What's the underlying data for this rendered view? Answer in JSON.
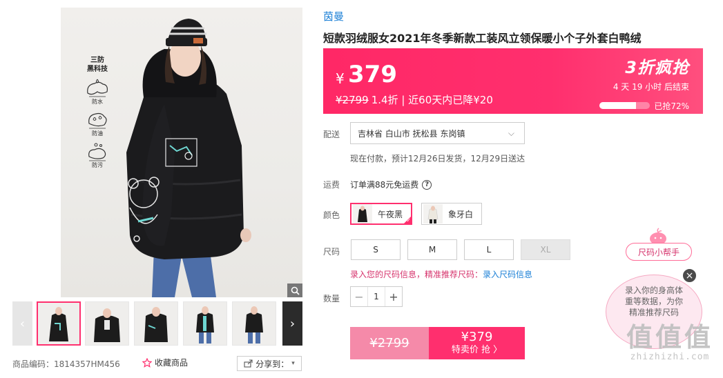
{
  "product": {
    "brand": "茵曼",
    "title": "短款羽绒服女2021年冬季新款工装风立领保暖小个子外套白鸭绒"
  },
  "gallery": {
    "tech_title_line1": "三防",
    "tech_title_line2": "黑科技",
    "features": [
      {
        "icon": "water-proof-icon",
        "label": "防水"
      },
      {
        "icon": "grease-proof-icon",
        "label": "防油"
      },
      {
        "icon": "anti-fouling-icon",
        "label": "防污"
      }
    ],
    "thumb_count": 5,
    "product_code": "商品编码：1814357HM456",
    "favorite_label": "收藏商品",
    "share_label": "分享到："
  },
  "pricing": {
    "currency": "¥",
    "price": "379",
    "original_price": "¥2799",
    "discount_text": "1.4折 | 近60天内已降¥20",
    "promo_label": "3折疯抢",
    "countdown": "4 天 19 小时 后结束",
    "sold_percent": 72,
    "sold_text": "已抢72%"
  },
  "delivery": {
    "label": "配送",
    "location": "吉林省 白山市 抚松县 东岗镇",
    "note": "现在付款，预计12月26日发货，12月29日送达"
  },
  "freight": {
    "label": "运费",
    "text": "订单满88元免运费"
  },
  "color": {
    "label": "颜色",
    "options": [
      {
        "name": "午夜黑",
        "selected": true
      },
      {
        "name": "象牙白",
        "selected": false
      }
    ]
  },
  "size": {
    "label": "尺码",
    "options": [
      {
        "name": "S",
        "disabled": false
      },
      {
        "name": "M",
        "disabled": false
      },
      {
        "name": "L",
        "disabled": false
      },
      {
        "name": "XL",
        "disabled": true
      }
    ],
    "help_text": "录入您的尺码信息，精准推荐尺码：",
    "help_link": "录入尺码信息"
  },
  "quantity": {
    "label": "数量",
    "value": "1",
    "minus": "−",
    "plus": "+"
  },
  "buy": {
    "was_price": "¥2799",
    "now_price": "¥379",
    "cta": "特卖价 抢 〉"
  },
  "size_helper": {
    "tag": "尺码小帮手",
    "bubble_line1": "录入你的身高体",
    "bubble_line2": "重等数据，为你",
    "bubble_line3": "精准推荐尺码",
    "close": "×"
  },
  "watermark": {
    "big": "值值值",
    "small": "zhizhizhi.com"
  },
  "colors": {
    "accent": "#ff2f6e",
    "brand_link": "#1a7fd6",
    "soft_pink": "#f58aa9"
  }
}
